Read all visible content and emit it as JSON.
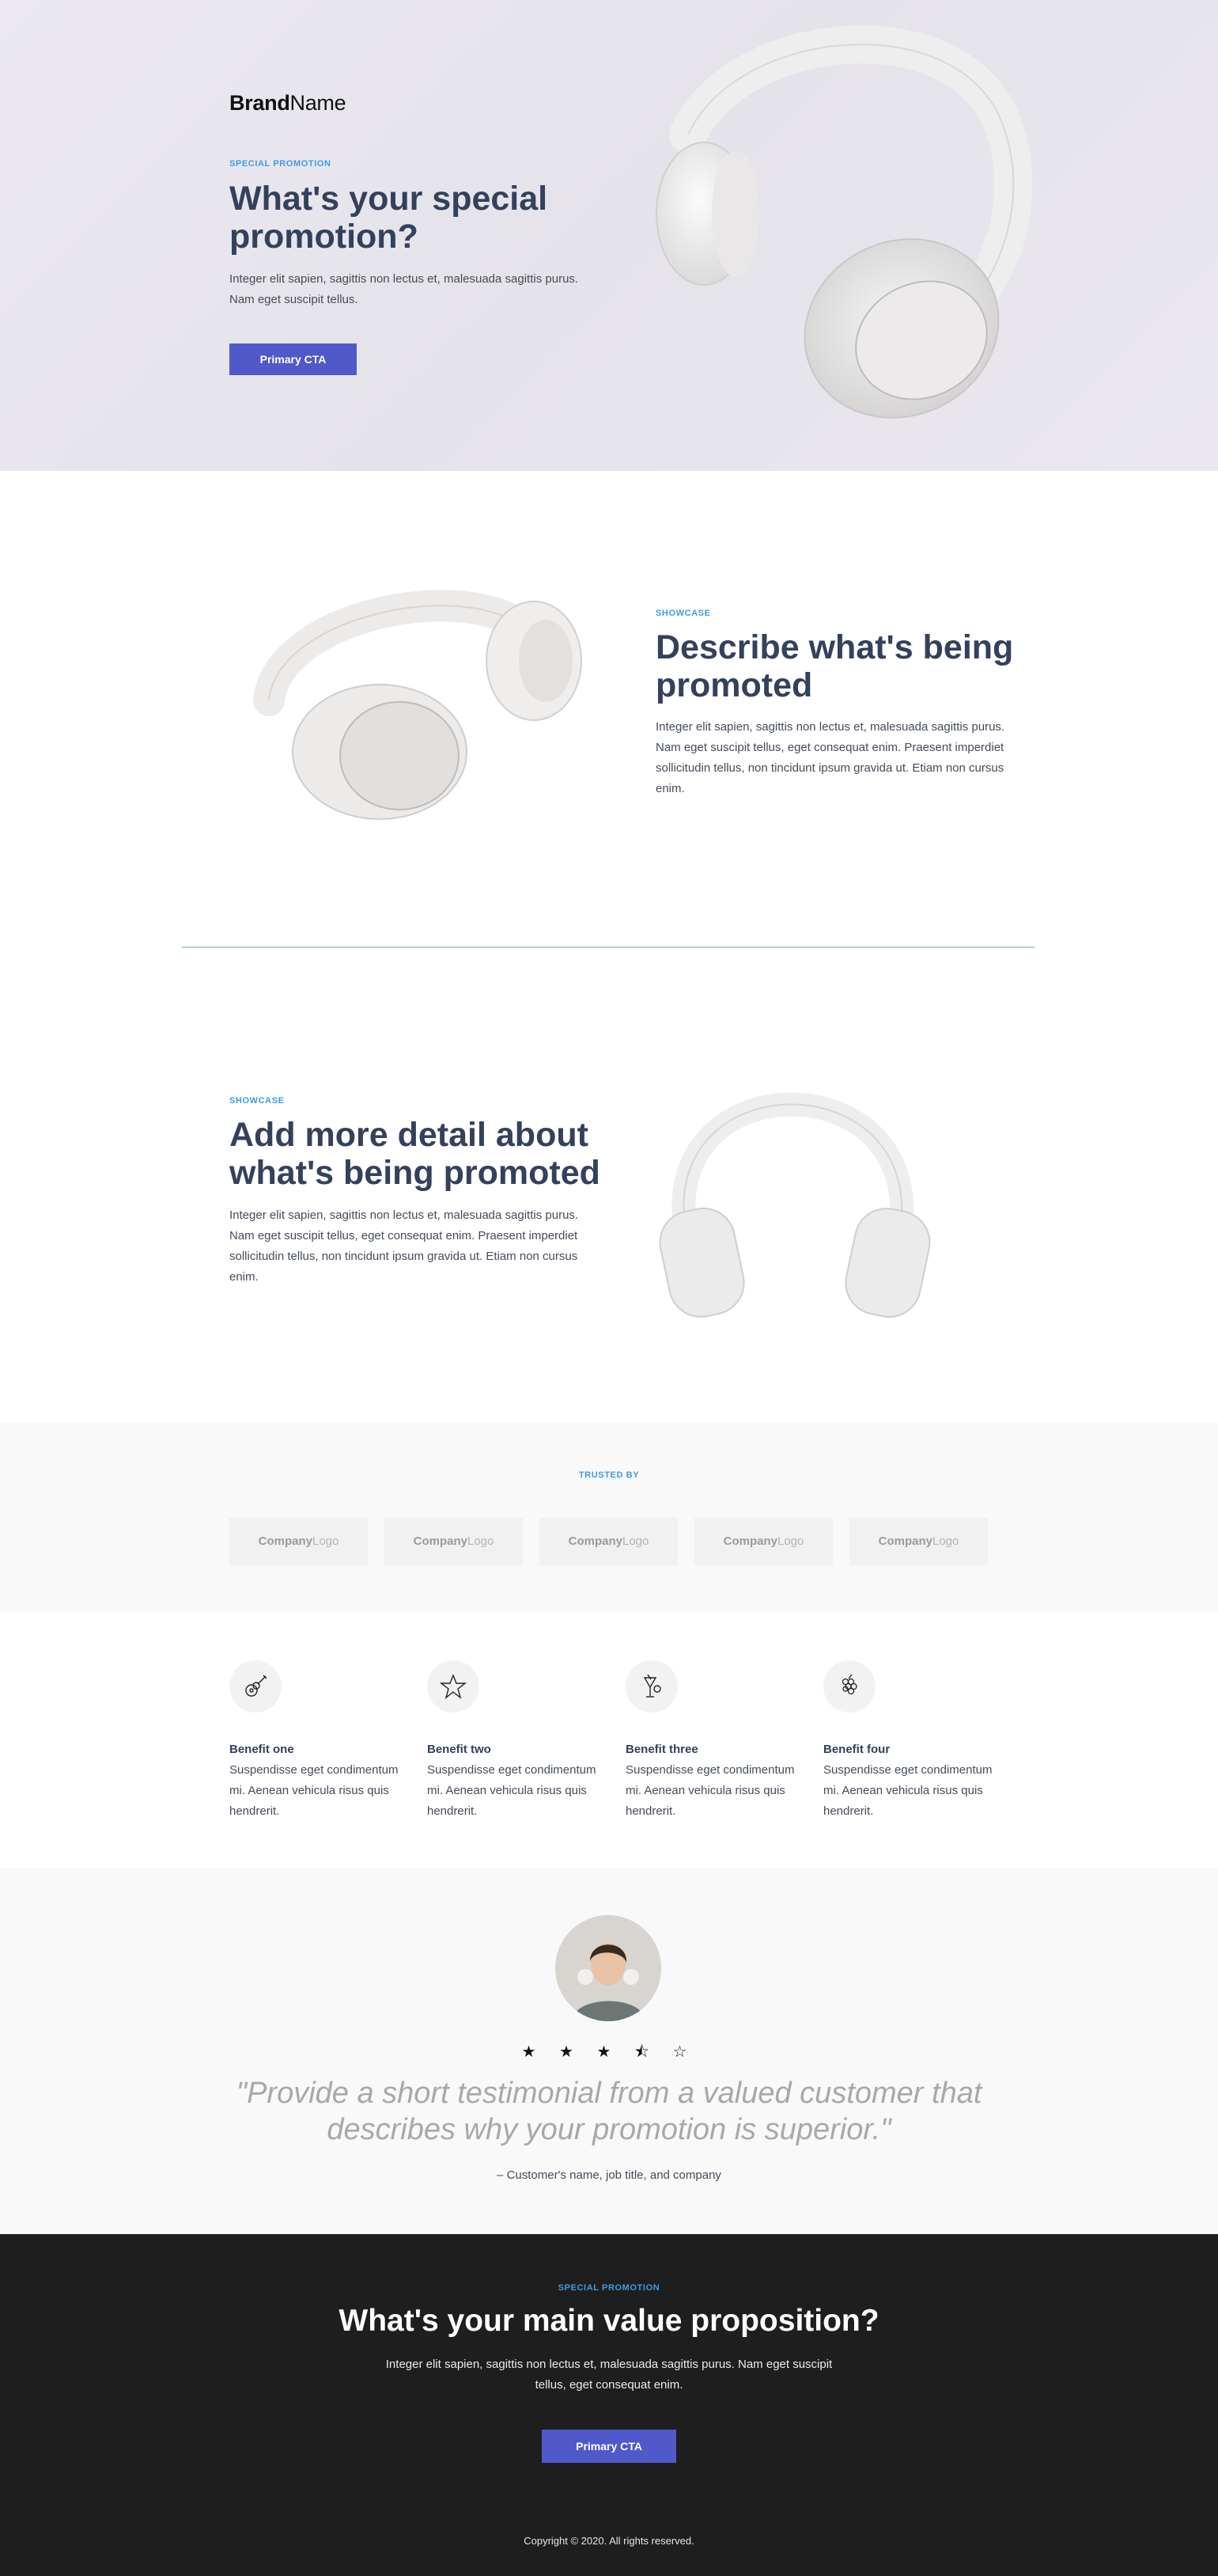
{
  "hero": {
    "brand_bold": "Brand",
    "brand_light": "Name",
    "eyebrow": "SPECIAL PROMOTION",
    "title": "What's your special promotion?",
    "body": "Integer elit sapien, sagittis non lectus et, malesuada sagittis purus. Nam eget suscipit tellus.",
    "cta": "Primary CTA"
  },
  "showcase1": {
    "eyebrow": "SHOWCASE",
    "title": "Describe what's being promoted",
    "body": "Integer elit sapien, sagittis non lectus et, malesuada sagittis purus. Nam eget suscipit tellus, eget consequat enim. Praesent imperdiet sollicitudin tellus, non tincidunt ipsum gravida ut. Etiam non cursus enim."
  },
  "showcase2": {
    "eyebrow": "SHOWCASE",
    "title": "Add more detail about what's being promoted",
    "body": "Integer elit sapien, sagittis non lectus et, malesuada sagittis purus. Nam eget suscipit tellus, eget consequat enim. Praesent imperdiet sollicitudin tellus, non tincidunt ipsum gravida ut. Etiam non cursus enim."
  },
  "trusted": {
    "eyebrow": "TRUSTED BY",
    "logos": [
      {
        "bold": "Company",
        "light": "Logo"
      },
      {
        "bold": "Company",
        "light": "Logo"
      },
      {
        "bold": "Company",
        "light": "Logo"
      },
      {
        "bold": "Company",
        "light": "Logo"
      },
      {
        "bold": "Company",
        "light": "Logo"
      }
    ]
  },
  "benefits": [
    {
      "icon": "guitar-icon",
      "title": "Benefit one",
      "desc": "Suspendisse eget condimentum mi. Aenean vehicula risus quis hendrerit."
    },
    {
      "icon": "star-icon",
      "title": "Benefit two",
      "desc": "Suspendisse eget condimentum mi. Aenean vehicula risus quis hendrerit."
    },
    {
      "icon": "cocktail-icon",
      "title": "Benefit three",
      "desc": "Suspendisse eget condimentum mi. Aenean vehicula risus quis hendrerit."
    },
    {
      "icon": "grapes-icon",
      "title": "Benefit four",
      "desc": "Suspendisse eget condimentum mi. Aenean vehicula risus quis hendrerit."
    }
  ],
  "testimonial": {
    "rating": 3.5,
    "rating_max": 5,
    "stars": "★ ★ ★ ⯪ ☆",
    "quote": "\"Provide a short testimonial from a valued customer that describes why your promotion is superior.\"",
    "attribution": "– Customer's name, job title, and company"
  },
  "footer_cta": {
    "eyebrow": "SPECIAL PROMOTION",
    "title": "What's your main value proposition?",
    "body": "Integer elit sapien, sagittis non lectus et, malesuada sagittis purus. Nam eget suscipit tellus, eget consequat enim.",
    "cta": "Primary CTA",
    "copyright": "Copyright © 2020. All rights reserved."
  },
  "colors": {
    "accent": "#5059c9",
    "eyebrow": "#3d9be9",
    "heading": "#33415c",
    "dark_bg": "#1e1e1e"
  }
}
